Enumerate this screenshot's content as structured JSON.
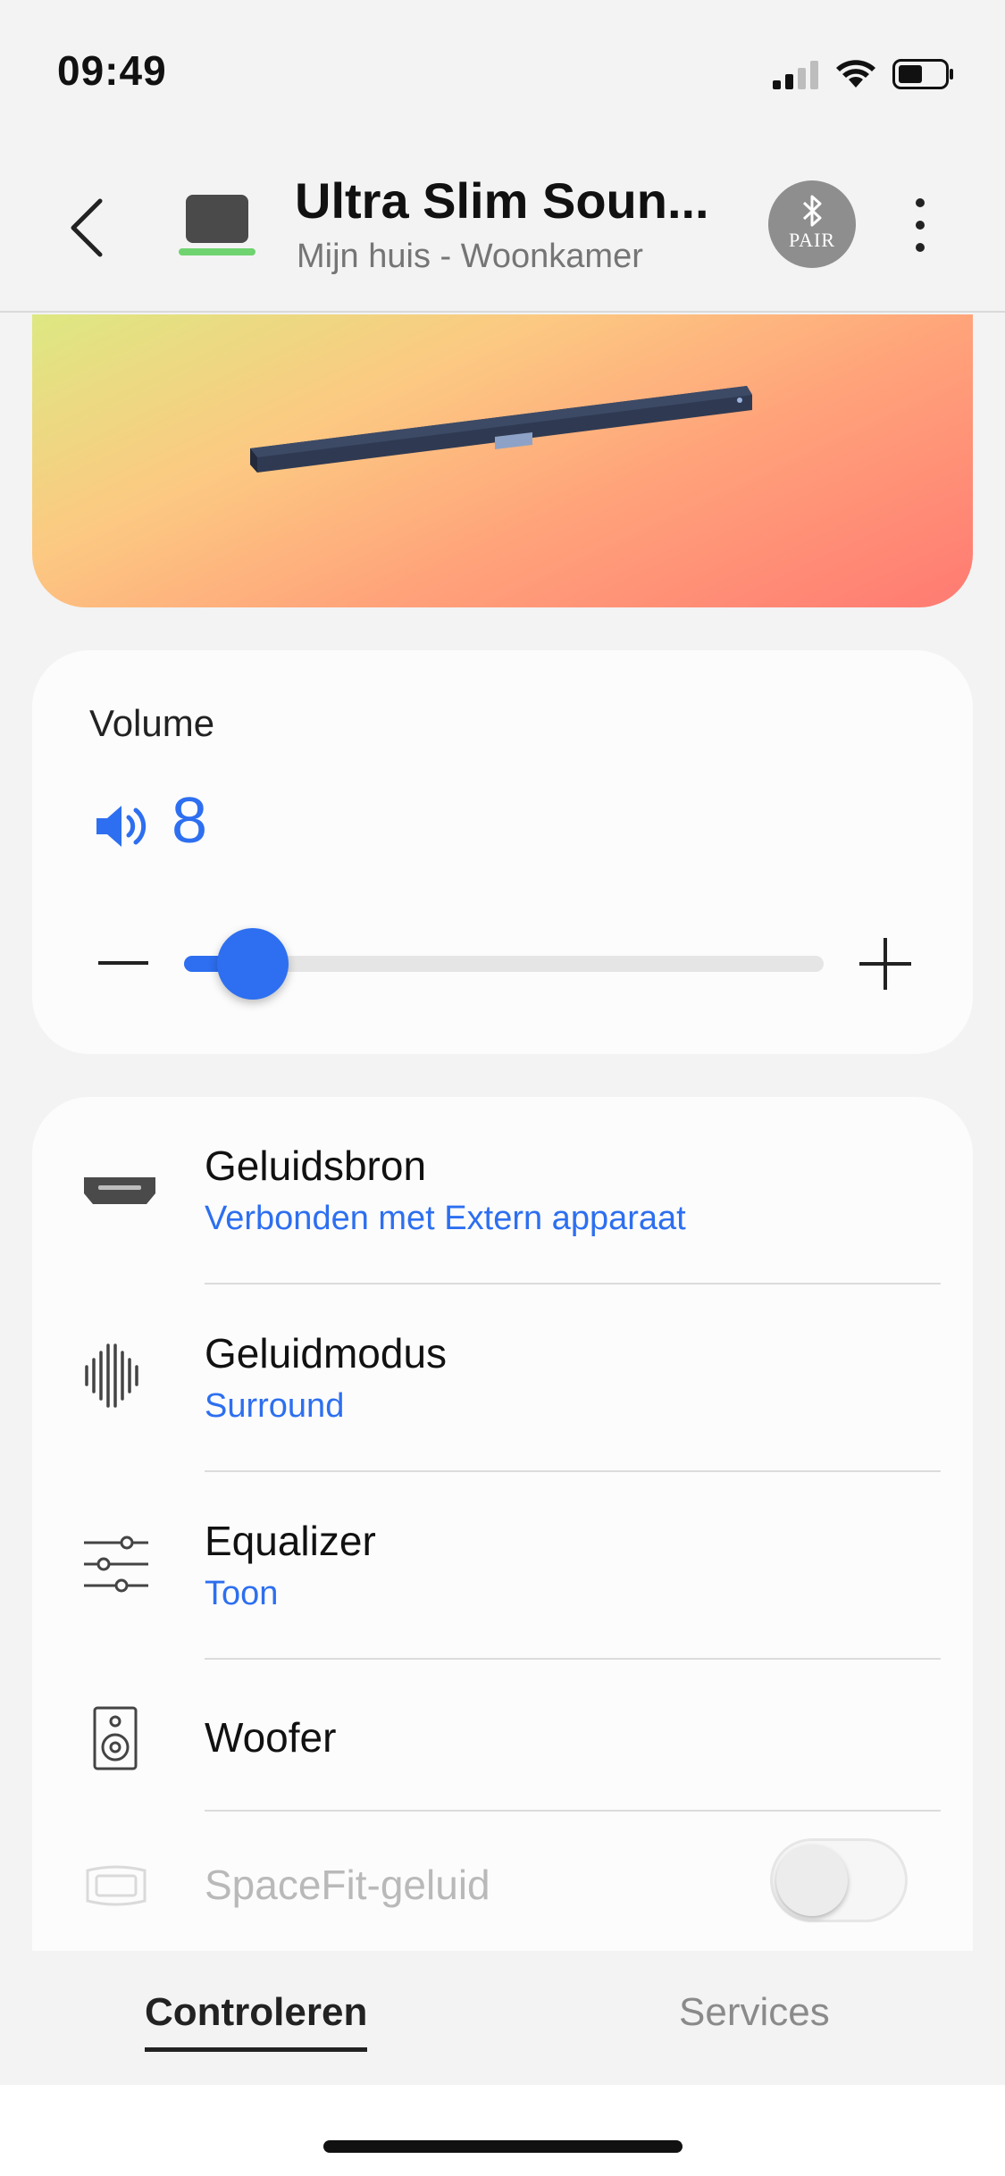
{
  "status_bar": {
    "time": "09:49"
  },
  "header": {
    "title": "Ultra Slim Soun...",
    "subtitle": "Mijn huis - Woonkamer",
    "pair_label": "PAIR"
  },
  "volume": {
    "label": "Volume",
    "value": "8",
    "level_fraction": 0.08
  },
  "settings": {
    "items": [
      {
        "title": "Geluidsbron",
        "subtitle": "Verbonden met Extern apparaat",
        "icon": "hdmi-icon"
      },
      {
        "title": "Geluidmodus",
        "subtitle": "Surround",
        "icon": "sound-wave-icon"
      },
      {
        "title": "Equalizer",
        "subtitle": "Toon",
        "icon": "equalizer-icon"
      },
      {
        "title": "Woofer",
        "subtitle": "",
        "icon": "speaker-icon"
      },
      {
        "title": "SpaceFit-geluid",
        "subtitle": "",
        "icon": "spacefit-icon",
        "disabled": true,
        "toggle": false
      }
    ]
  },
  "tabs": {
    "active": "Controleren",
    "inactive": "Services"
  },
  "colors": {
    "accent": "#2d6ff0",
    "hero_gradient": [
      "#dde882",
      "#fcc982",
      "#ffa27a",
      "#ff7a72"
    ]
  }
}
